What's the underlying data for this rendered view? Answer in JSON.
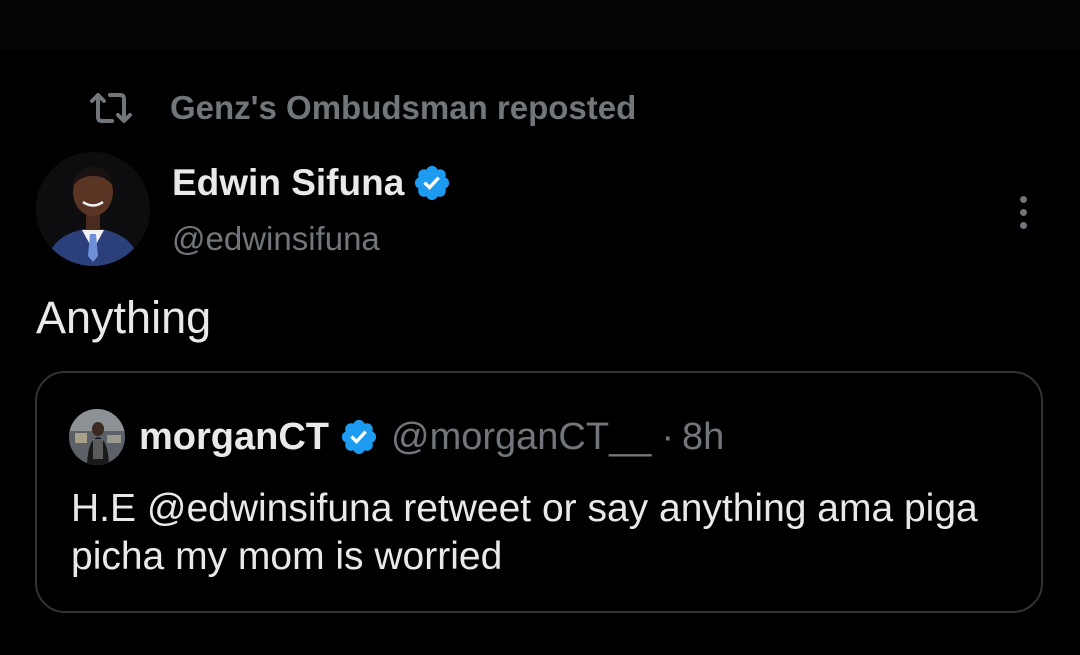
{
  "repost": {
    "icon": "repost-icon",
    "text": "Genz's Ombudsman reposted"
  },
  "tweet": {
    "author": {
      "name": "Edwin Sifuna",
      "handle": "@edwinsifuna",
      "verified": true,
      "avatar": "avatar"
    },
    "more_icon": "more-dots-icon",
    "text": "Anything"
  },
  "quote": {
    "author": {
      "name": "morganCT",
      "handle": "@morganCT__",
      "verified": true,
      "avatar": "avatar"
    },
    "separator": "·",
    "time": "8h",
    "text": "H.E @edwinsifuna retweet or say anything ama piga picha my mom is worried"
  },
  "colors": {
    "background": "#000000",
    "primary_text": "#e7e9ea",
    "secondary_text": "#71767b",
    "verified_badge": "#1d9bf0",
    "card_border": "#2f3336"
  }
}
